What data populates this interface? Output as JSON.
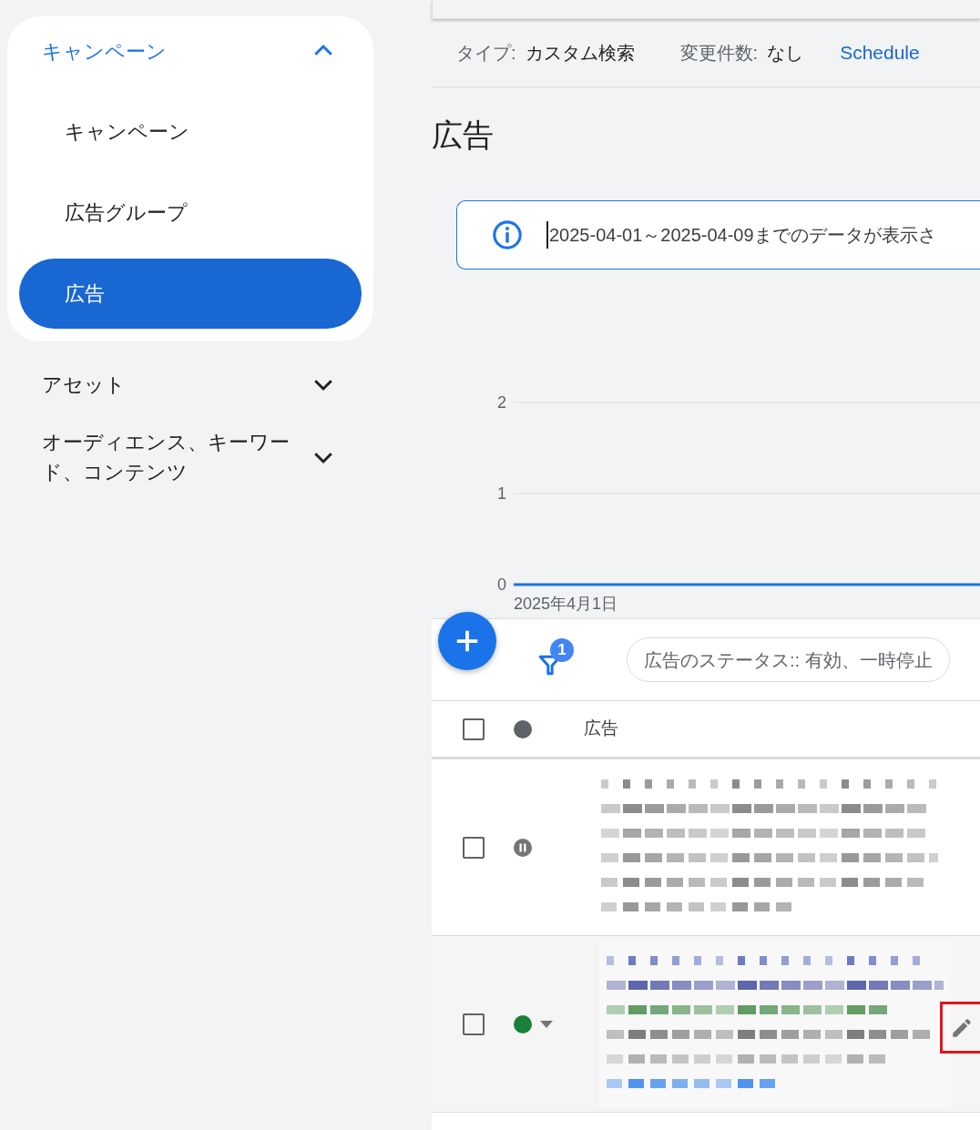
{
  "sidebar": {
    "group": {
      "label": "キャンペーン",
      "expanded": true,
      "items": [
        {
          "label": "キャンペーン",
          "selected": false
        },
        {
          "label": "広告グループ",
          "selected": false
        },
        {
          "label": "広告",
          "selected": true
        }
      ]
    },
    "sections": [
      {
        "label": "アセット",
        "expanded": false
      },
      {
        "label": "オーディエンス、キーワード、コンテンツ",
        "expanded": false
      }
    ]
  },
  "summary": [
    {
      "key": "タイプ:",
      "value": "カスタム検索"
    },
    {
      "key": "変更件数:",
      "value": "なし"
    }
  ],
  "schedule_link": "Schedule",
  "heading": "広告",
  "notice": "2025-04-01～2025-04-09までのデータが表示さ",
  "chart": {
    "y_labels": [
      "2",
      "1",
      "0"
    ],
    "x_label": "2025年4月1日"
  },
  "filter": {
    "count": "1",
    "chip": "広告のステータス:: 有効、一時停止"
  },
  "table": {
    "header": {
      "checked": false,
      "column_label": "広告"
    },
    "rows": [
      {
        "checked": false,
        "kind": "paused",
        "hovered": false
      },
      {
        "checked": false,
        "kind": "enabled",
        "hovered": true
      }
    ]
  }
}
